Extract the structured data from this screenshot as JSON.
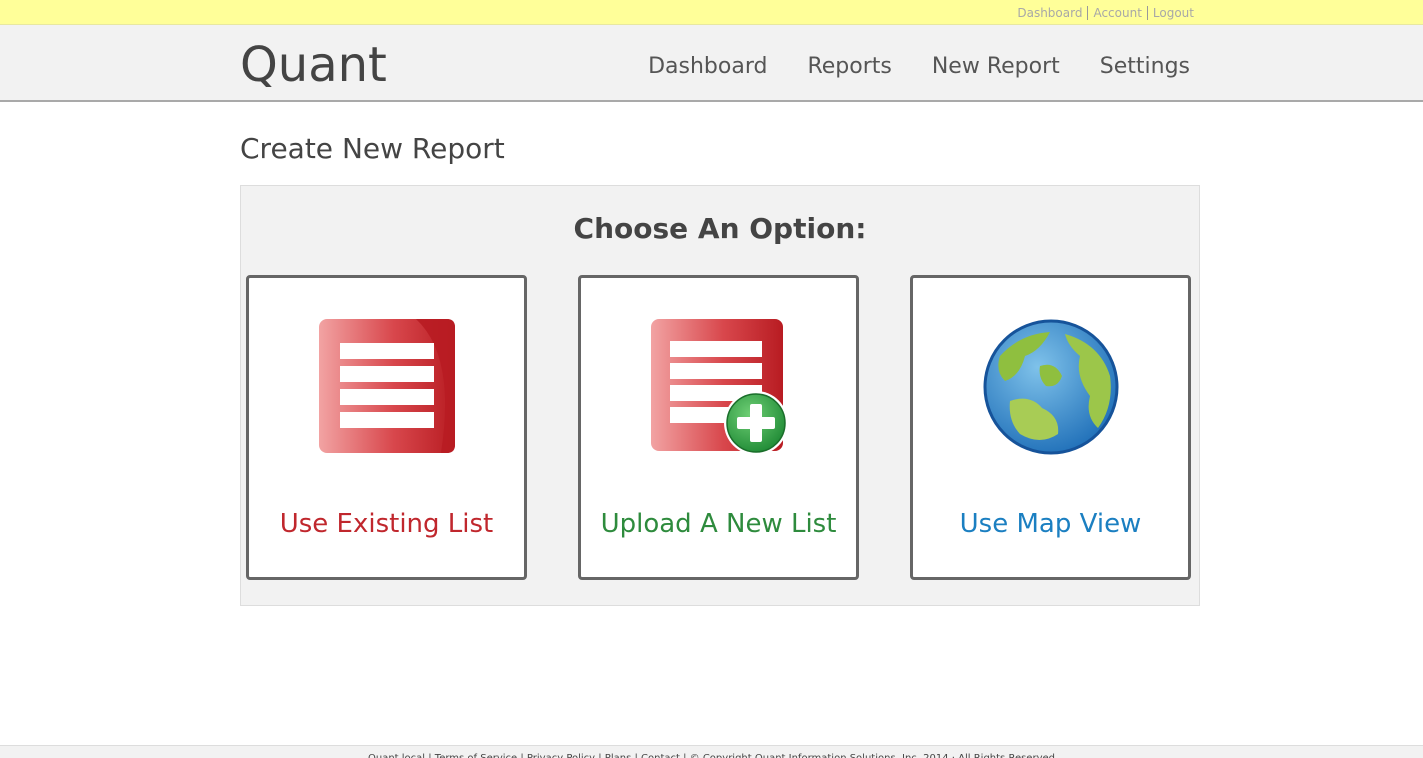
{
  "topbar": {
    "links": [
      "Dashboard",
      "Account",
      "Logout"
    ]
  },
  "header": {
    "logo": "Quant",
    "nav": [
      "Dashboard",
      "Reports",
      "New Report",
      "Settings"
    ]
  },
  "page": {
    "title": "Create New Report"
  },
  "panel": {
    "title": "Choose An Option:",
    "options": [
      {
        "label": "Use Existing List",
        "color": "#c0272d",
        "icon": "list-icon"
      },
      {
        "label": "Upload A New List",
        "color": "#2e8b3d",
        "icon": "list-add-icon"
      },
      {
        "label": "Use Map View",
        "color": "#1b7fc1",
        "icon": "globe-icon"
      }
    ]
  },
  "footer": {
    "text": "Quant.local | Terms of Service | Privacy Policy | Plans | Contact | © Copyright Quant Information Solutions, Inc. 2014 · All Rights Reserved"
  }
}
